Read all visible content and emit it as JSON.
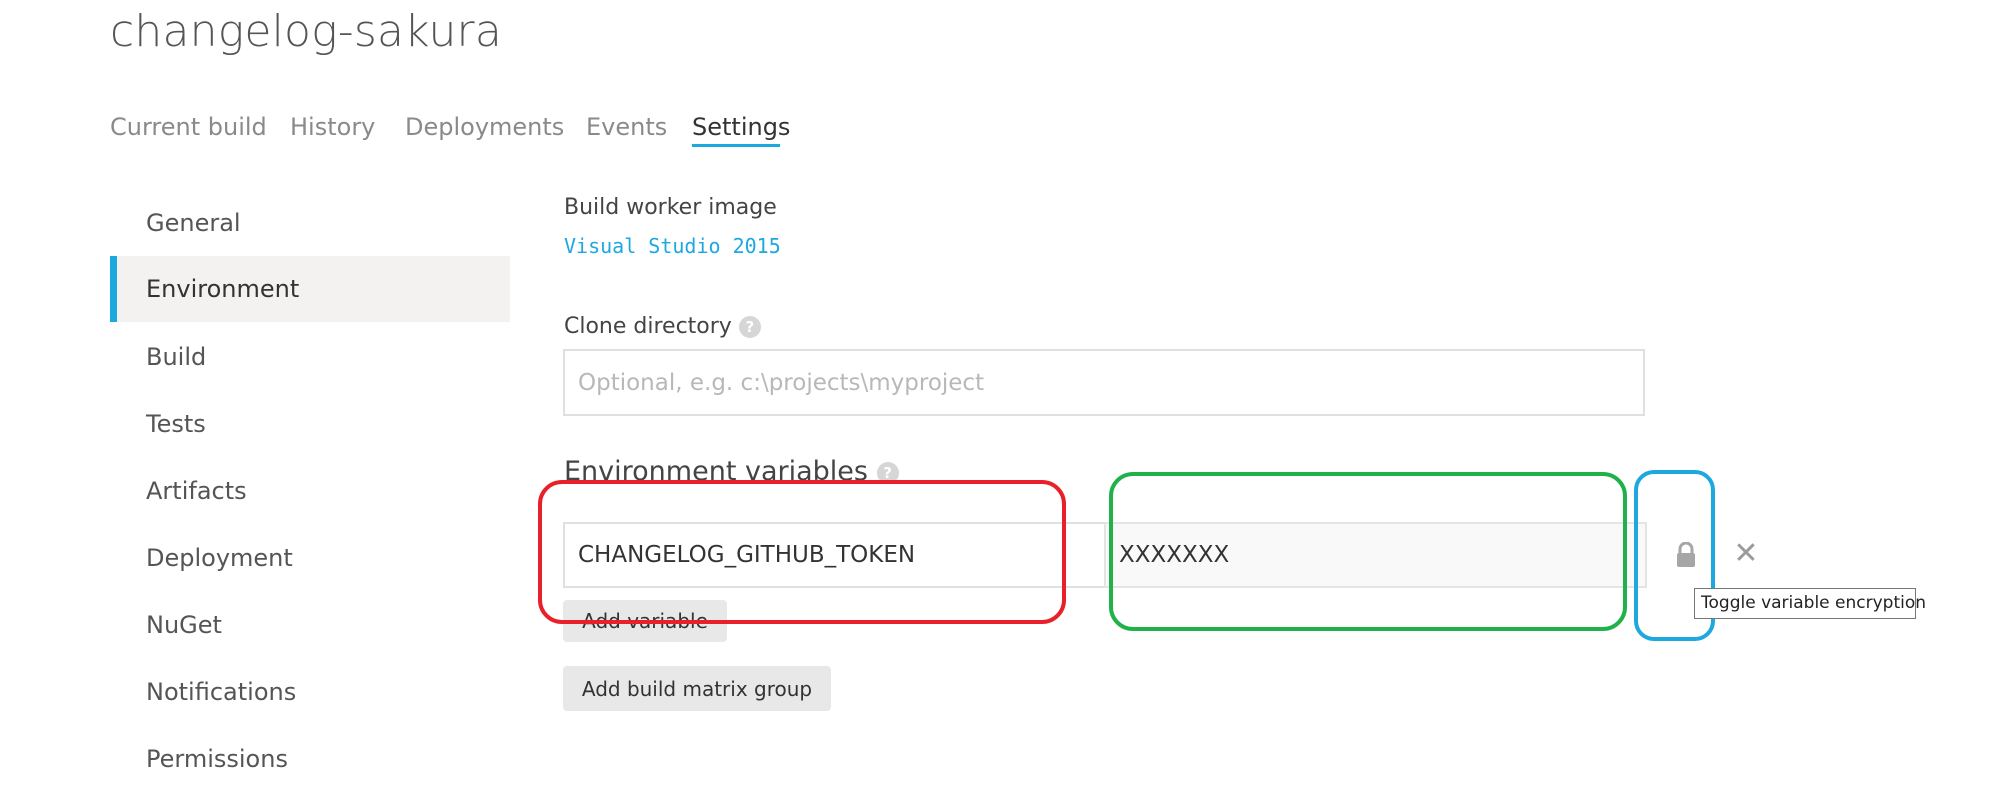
{
  "page": {
    "title": "changelog-sakura"
  },
  "tabs": [
    {
      "label": "Current build",
      "active": false
    },
    {
      "label": "History",
      "active": false
    },
    {
      "label": "Deployments",
      "active": false
    },
    {
      "label": "Events",
      "active": false
    },
    {
      "label": "Settings",
      "active": true
    }
  ],
  "sidebar": {
    "items": [
      {
        "label": "General",
        "active": false
      },
      {
        "label": "Environment",
        "active": true
      },
      {
        "label": "Build",
        "active": false
      },
      {
        "label": "Tests",
        "active": false
      },
      {
        "label": "Artifacts",
        "active": false
      },
      {
        "label": "Deployment",
        "active": false
      },
      {
        "label": "NuGet",
        "active": false
      },
      {
        "label": "Notifications",
        "active": false
      },
      {
        "label": "Permissions",
        "active": false
      }
    ]
  },
  "build_worker": {
    "label": "Build worker image",
    "value": "Visual Studio 2015"
  },
  "clone_directory": {
    "label": "Clone directory",
    "placeholder": "Optional, e.g. c:\\projects\\myproject",
    "help_glyph": "?"
  },
  "env_vars": {
    "title": "Environment variables",
    "help_glyph": "?",
    "rows": [
      {
        "name": "CHANGELOG_GITHUB_TOKEN",
        "value": "XXXXXXX"
      }
    ],
    "encrypt_icon": "lock-icon",
    "remove_icon": "close-icon",
    "remove_glyph": "✕",
    "add_variable_label": "Add variable",
    "add_matrix_label": "Add build matrix group"
  },
  "tooltip": {
    "text": "Toggle variable encryption"
  },
  "annotations": {
    "name_box_color": "#e8202a",
    "value_box_color": "#20b14a",
    "lock_box_color": "#1ea8e0"
  },
  "colors": {
    "accent": "#1ea8e0",
    "active_bg": "#f3f2f1"
  }
}
